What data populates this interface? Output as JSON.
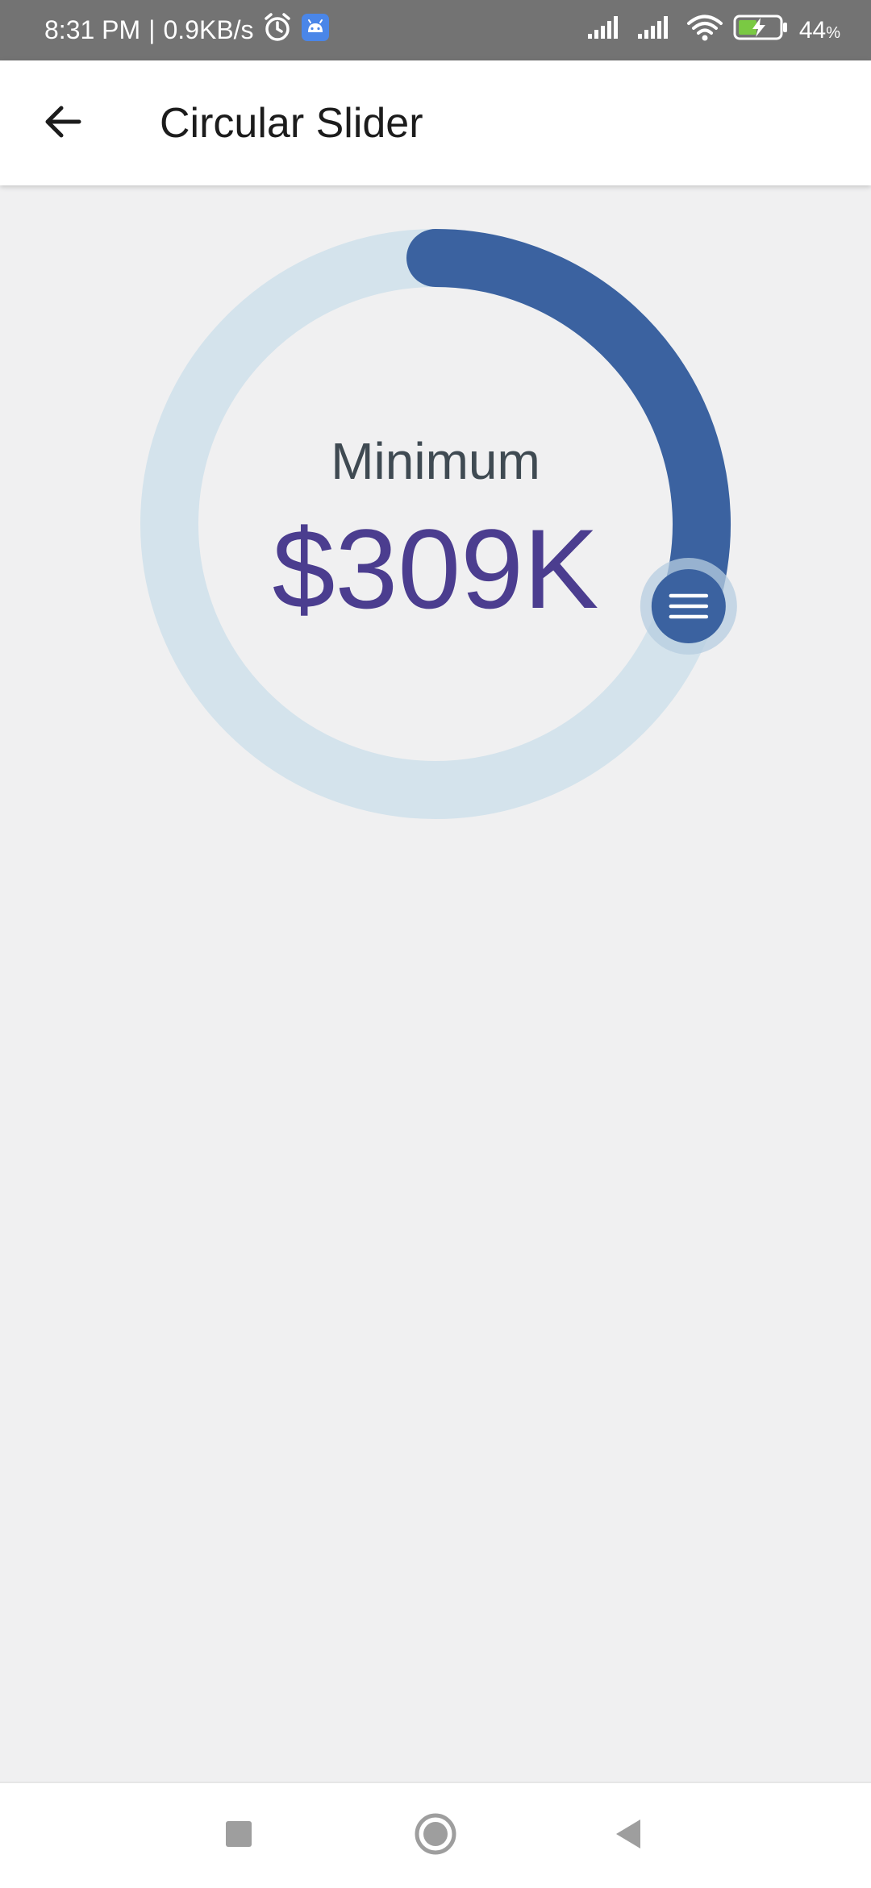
{
  "status_bar": {
    "time": "8:31 PM",
    "separator": "|",
    "network_speed": "0.9KB/s",
    "battery_percent": "44",
    "battery_unit": "%",
    "icons": [
      "alarm-icon",
      "android-notification-icon",
      "signal-icon",
      "signal-icon",
      "wifi-icon",
      "battery-charging-icon"
    ]
  },
  "app_bar": {
    "title": "Circular Slider",
    "back_icon": "arrow-left-icon"
  },
  "slider": {
    "label": "Minimum",
    "value": "$309K",
    "fill_fraction": 0.3,
    "handle_icon": "menu-lines-icon",
    "colors": {
      "track": "#d4e3ec",
      "progress": "#3b62a0",
      "handle_halo": "#b7cde0",
      "value_text": "#4b3d8f",
      "label_text": "#3f4a52"
    }
  },
  "nav_bar": {
    "icons": [
      "recent-apps-square-icon",
      "home-circle-icon",
      "back-triangle-icon"
    ]
  }
}
